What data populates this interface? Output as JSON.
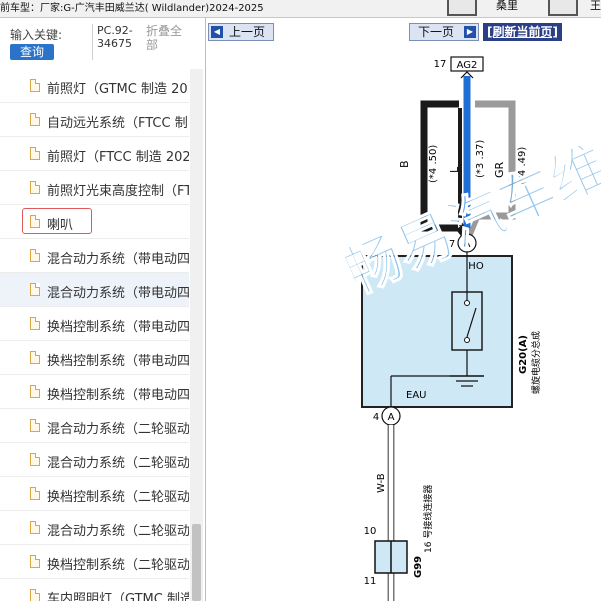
{
  "app": {
    "vehicle_line": "前车型：厂家:G-广汽丰田威兰达( Wildlander)2024-2025",
    "toolbar_label_1": "桑里",
    "toolbar_label_2": "王"
  },
  "search": {
    "label": "输入关键:",
    "button": "查询",
    "code": "PC.92-34675",
    "fold": "折叠全部"
  },
  "tree": {
    "items": [
      {
        "label": "前照灯（GTMC 制造 20"
      },
      {
        "label": "自动远光系统（FTCC 制"
      },
      {
        "label": "前照灯（FTCC 制造 202"
      },
      {
        "label": "前照灯光束高度控制（FT"
      },
      {
        "label": "喇叭"
      },
      {
        "label": "混合动力系统（带电动四"
      },
      {
        "label": "混合动力系统（带电动四"
      },
      {
        "label": "换档控制系统（带电动四"
      },
      {
        "label": "换档控制系统（带电动四"
      },
      {
        "label": "换档控制系统（带电动四"
      },
      {
        "label": "混合动力系统（二轮驱动"
      },
      {
        "label": "混合动力系统（二轮驱动"
      },
      {
        "label": "换档控制系统（二轮驱动"
      },
      {
        "label": "混合动力系统（二轮驱动"
      },
      {
        "label": "换档控制系统（二轮驱动"
      },
      {
        "label": "车内照明灯（GTMC 制造"
      }
    ]
  },
  "nav": {
    "prev": "上一页",
    "next": "下一页",
    "refresh": "[刷新当前页]"
  },
  "diagram": {
    "pin_17": "17",
    "connector_ag2": "AG2",
    "wire_b": "B",
    "wire_l": "L",
    "wire_gr": "GR",
    "wire_code_left": "(*4 .50)",
    "wire_code_mid": "(*3 .37)",
    "wire_code_right": "(*4 .49)",
    "pin_7": "7",
    "splice_a": "A",
    "ho": "HO",
    "eau": "EAU",
    "component_code": "G20(A)",
    "component_name": "螺旋电缆分总成",
    "pin_4": "4",
    "wire_wb": "W-B",
    "connector_note": "16 号接线连接器",
    "pin_10": "10",
    "pin_11": "11",
    "g99": "G99",
    "watermark": "畅易汽车维"
  },
  "colors": {
    "wire_blue": "#1f6fd6",
    "wire_black": "#1a1a1a",
    "wire_gray": "#9a9a9a",
    "component_fill": "#cfe8f6",
    "watermark": "#6fb3e6",
    "accent_button": "#2a73c9"
  }
}
